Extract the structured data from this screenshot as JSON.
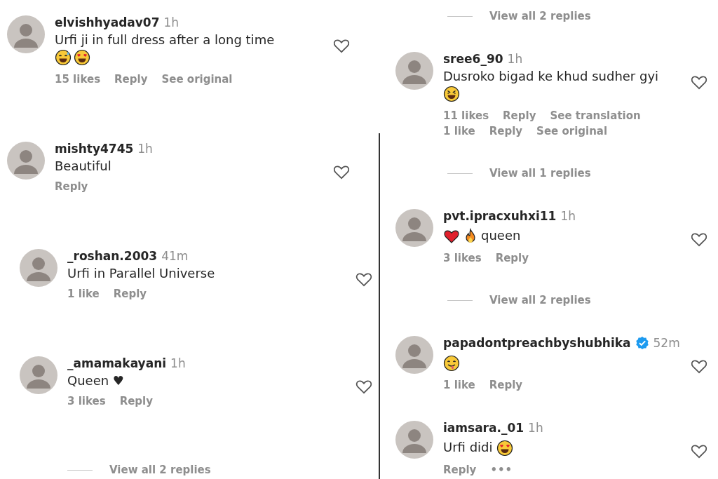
{
  "columns": [
    {
      "items": [
        {
          "kind": "comment",
          "indented": false,
          "username": "elvishhyadav07",
          "verified": false,
          "time": "1h",
          "body": [
            {
              "kind": "text",
              "text": "Urfi ji in full dress after a long time"
            },
            {
              "kind": "break"
            },
            {
              "kind": "grin_sweat"
            },
            {
              "kind": "heart_eyes"
            }
          ],
          "action_rows": [
            [
              {
                "kind": "likes",
                "text": "15 likes"
              },
              {
                "kind": "link",
                "text": "Reply"
              },
              {
                "kind": "link",
                "text": "See original"
              }
            ]
          ]
        },
        {
          "kind": "comment",
          "indented": false,
          "username": "mishty4745",
          "verified": false,
          "time": "1h",
          "body": [
            {
              "kind": "text",
              "text": "Beautiful"
            }
          ],
          "action_rows": [
            [
              {
                "kind": "link",
                "text": "Reply"
              }
            ]
          ]
        },
        {
          "kind": "comment",
          "indented": true,
          "username": "_roshan.2003",
          "verified": false,
          "time": "41m",
          "body": [
            {
              "kind": "text",
              "text": "Urfi in Parallel Universe"
            }
          ],
          "action_rows": [
            [
              {
                "kind": "likes",
                "text": "1 like"
              },
              {
                "kind": "link",
                "text": "Reply"
              }
            ]
          ]
        },
        {
          "kind": "comment",
          "indented": true,
          "username": "_amamakayani",
          "verified": false,
          "time": "1h",
          "body": [
            {
              "kind": "text",
              "text": "Queen ♥"
            }
          ],
          "action_rows": [
            [
              {
                "kind": "likes",
                "text": "3 likes"
              },
              {
                "kind": "link",
                "text": "Reply"
              }
            ]
          ]
        },
        {
          "kind": "view_replies",
          "text": "View all 2 replies"
        }
      ]
    },
    {
      "items": [
        {
          "kind": "view_replies",
          "text": "View all 2 replies"
        },
        {
          "kind": "comment",
          "indented": false,
          "username": "sree6_90",
          "verified": false,
          "time": "1h",
          "body": [
            {
              "kind": "text",
              "text": "Dusroko bigad ke khud sudher gyi"
            },
            {
              "kind": "break"
            },
            {
              "kind": "squint_laugh"
            }
          ],
          "action_rows": [
            [
              {
                "kind": "likes",
                "text": "11 likes"
              },
              {
                "kind": "link",
                "text": "Reply"
              },
              {
                "kind": "link",
                "text": "See translation"
              }
            ],
            [
              {
                "kind": "likes",
                "text": "1 like"
              },
              {
                "kind": "link",
                "text": "Reply"
              },
              {
                "kind": "link",
                "text": "See original"
              }
            ]
          ]
        },
        {
          "kind": "view_replies",
          "text": "View all 1 replies"
        },
        {
          "kind": "comment",
          "indented": false,
          "username": "pvt.ipracxuhxi11",
          "verified": false,
          "time": "1h",
          "body": [
            {
              "kind": "red_heart"
            },
            {
              "kind": "fire"
            },
            {
              "kind": "text",
              "text": "queen"
            }
          ],
          "action_rows": [
            [
              {
                "kind": "likes",
                "text": "3 likes"
              },
              {
                "kind": "link",
                "text": "Reply"
              }
            ]
          ]
        },
        {
          "kind": "view_replies",
          "text": "View all 2 replies"
        },
        {
          "kind": "comment",
          "indented": false,
          "username": "papadontpreachbyshubhika",
          "verified": true,
          "time": "52m",
          "body": [
            {
              "kind": "yum"
            }
          ],
          "action_rows": [
            [
              {
                "kind": "likes",
                "text": "1 like"
              },
              {
                "kind": "link",
                "text": "Reply"
              }
            ]
          ]
        },
        {
          "kind": "comment",
          "indented": false,
          "username": "iamsara._01",
          "verified": false,
          "time": "1h",
          "body": [
            {
              "kind": "text",
              "text": "Urfi didi "
            },
            {
              "kind": "heart_eyes"
            }
          ],
          "action_rows": [
            [
              {
                "kind": "link",
                "text": "Reply"
              },
              {
                "kind": "more",
                "text": "•••"
              }
            ]
          ]
        }
      ]
    }
  ]
}
